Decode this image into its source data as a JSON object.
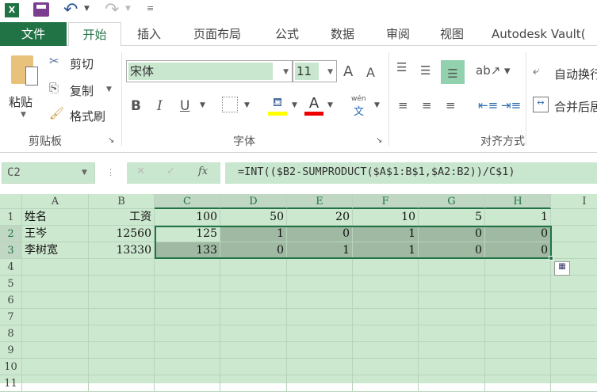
{
  "qat": {
    "icons": [
      "excel-icon",
      "save-icon",
      "undo-icon",
      "redo-icon",
      "customize-icon"
    ]
  },
  "tabs": [
    "文件",
    "开始",
    "插入",
    "页面布局",
    "公式",
    "数据",
    "审阅",
    "视图",
    "Autodesk Vault("
  ],
  "clipboard": {
    "paste": "粘贴",
    "cut": "剪切",
    "copy": "复制",
    "format_painter": "格式刷",
    "label": "剪贴板"
  },
  "font": {
    "name": "宋体",
    "size": "11",
    "bold": "B",
    "italic": "I",
    "underline": "U",
    "grow": "A",
    "shrink": "A",
    "font_color": "A",
    "phonetic_top": "wén",
    "phonetic": "文",
    "label": "字体"
  },
  "alignment": {
    "wrap": "自动换行",
    "merge": "合并后居中",
    "label": "对齐方式"
  },
  "formula_bar": {
    "name_box": "C2",
    "formula": "=INT(($B2-SUMPRODUCT($A$1:B$1,$A2:B2))/C$1)",
    "fx": "fx"
  },
  "columns": [
    "A",
    "B",
    "C",
    "D",
    "E",
    "F",
    "G",
    "H",
    "I"
  ],
  "rows": [
    "1",
    "2",
    "3",
    "4",
    "5",
    "6",
    "7",
    "8",
    "9",
    "10",
    "11"
  ],
  "cells": [
    [
      "姓名",
      "工资",
      "100",
      "50",
      "20",
      "10",
      "5",
      "1"
    ],
    [
      "王岑",
      "12560",
      "125",
      "1",
      "0",
      "1",
      "0",
      "0"
    ],
    [
      "李树宽",
      "13330",
      "133",
      "0",
      "1",
      "1",
      "0",
      "0"
    ]
  ],
  "colors": {
    "accent": "#217346",
    "sheet_bg": "#cce8cf",
    "selection": "#9fb9a3"
  }
}
